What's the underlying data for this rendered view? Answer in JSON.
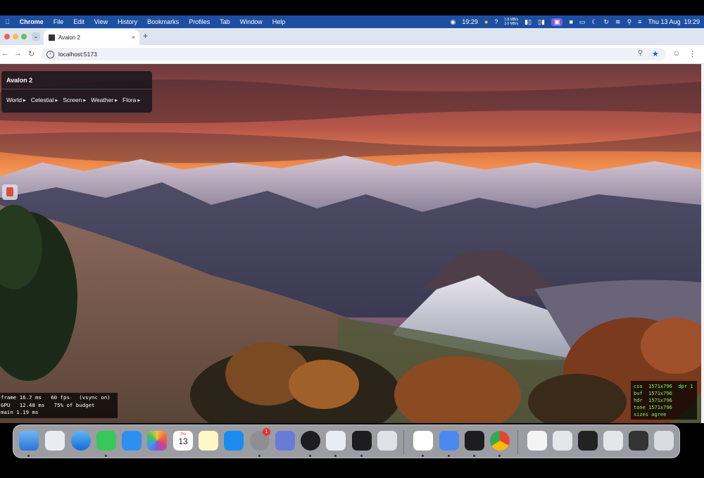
{
  "menubar": {
    "app": "Chrome",
    "items": [
      "File",
      "Edit",
      "View",
      "History",
      "Bookmarks",
      "Profiles",
      "Tab",
      "Window",
      "Help"
    ],
    "time_left": "19:29",
    "net_up": "1.8 MB/s",
    "net_down": "2.6 MB/s",
    "datetime": "Thu 13 Aug  19:29"
  },
  "tab": {
    "title": "Avalon 2",
    "close": "×",
    "new": "+"
  },
  "toolbar": {
    "url": "localhost:5173"
  },
  "panel": {
    "title": "Avalon 2",
    "menus": [
      "World",
      "Celestial",
      "Screen",
      "Weather",
      "Flora"
    ]
  },
  "stats": {
    "line1": "frame 16.7 ms   60 fps   (vsync on)",
    "line2": "GPU   12.48 ms   75% of budget",
    "line3": "main 1.19 ms"
  },
  "debug": {
    "css": "css  1571x796  dpr 1",
    "buf": "buf  1571x796",
    "hdr": "hdr  1571x796",
    "tone": "tone 1571x796",
    "sizes": "sizes agree"
  },
  "dock": {
    "calendar_month": "Thu",
    "calendar_day": "13",
    "settings_badge": "1"
  },
  "colors": {
    "menubar": "#1d4fa1",
    "sky_glow": "#f08a4a",
    "panel_bg": "#18161c",
    "debug_text": "#7cff5e"
  }
}
